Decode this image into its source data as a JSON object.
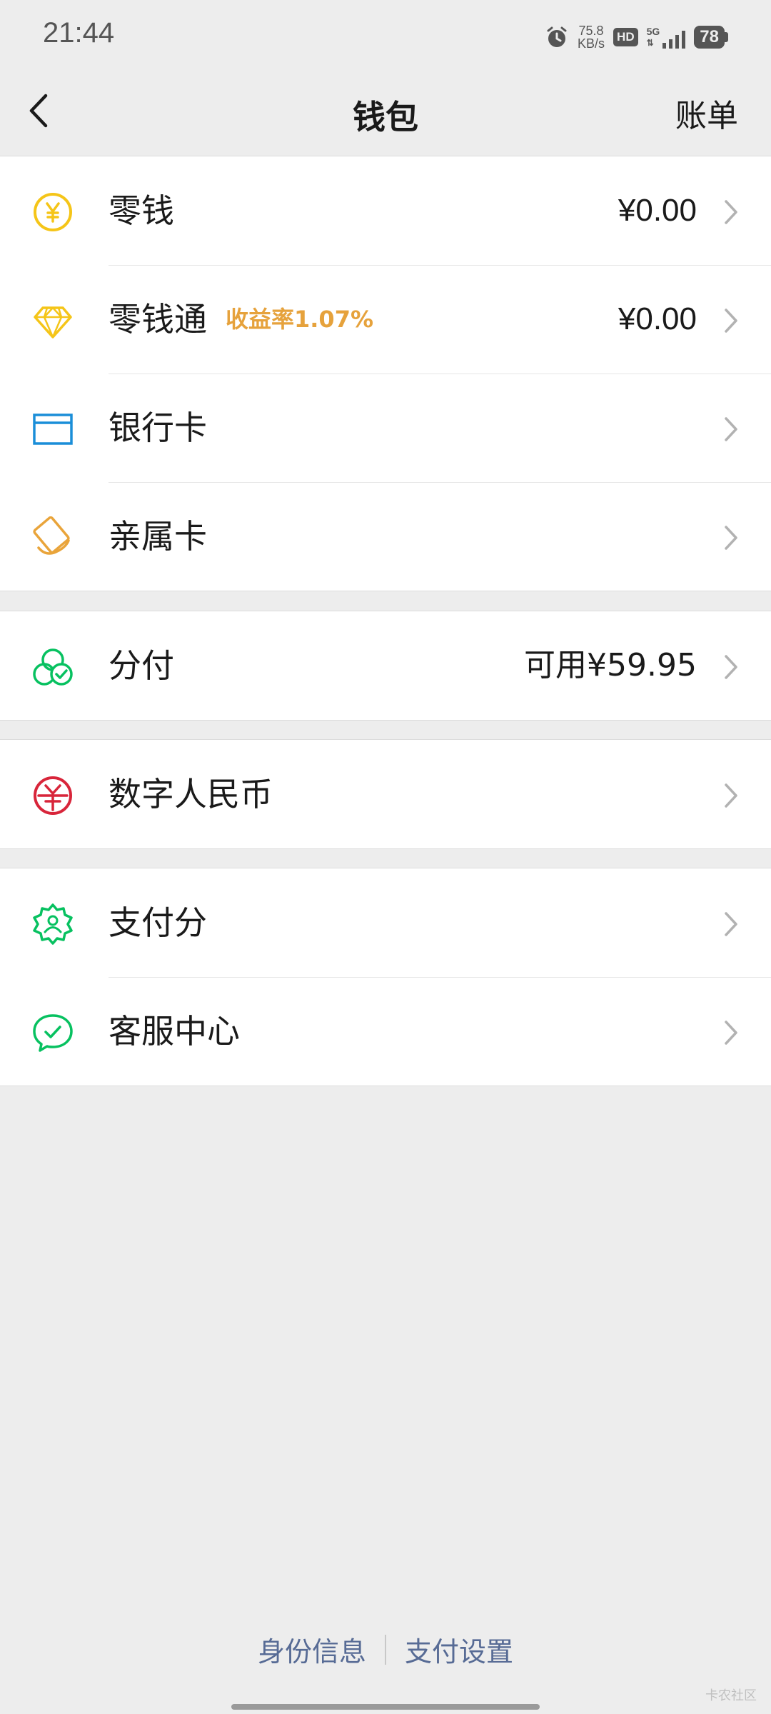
{
  "status_bar": {
    "time": "21:44",
    "net_speed_value": "75.8",
    "net_speed_unit": "KB/s",
    "hd_label": "HD",
    "network_label": "5G",
    "battery": "78"
  },
  "nav": {
    "title": "钱包",
    "action": "账单"
  },
  "wallet_rows": [
    {
      "label": "零钱",
      "value": "¥0.00",
      "icon": "yuan-coin-icon"
    },
    {
      "label": "零钱通",
      "tag": "收益率1.07%",
      "value": "¥0.00",
      "icon": "diamond-icon"
    },
    {
      "label": "银行卡",
      "icon": "bank-card-icon"
    },
    {
      "label": "亲属卡",
      "icon": "family-card-icon"
    }
  ],
  "credit_row": {
    "label": "分付",
    "value": "可用¥59.95",
    "icon": "fenfu-icon"
  },
  "ecny_row": {
    "label": "数字人民币",
    "icon": "digital-rmb-icon"
  },
  "service_rows": [
    {
      "label": "支付分",
      "icon": "payscore-icon"
    },
    {
      "label": "客服中心",
      "icon": "customer-service-icon"
    }
  ],
  "footer": {
    "identity": "身份信息",
    "settings": "支付设置"
  },
  "watermark": "卡农社区",
  "colors": {
    "background": "#ededed",
    "link": "#576b95",
    "accent_orange": "#e6a23c",
    "icon_yellow": "#f5c518",
    "icon_blue": "#1a8ed8",
    "icon_green": "#07c160",
    "icon_red": "#d8253a"
  }
}
